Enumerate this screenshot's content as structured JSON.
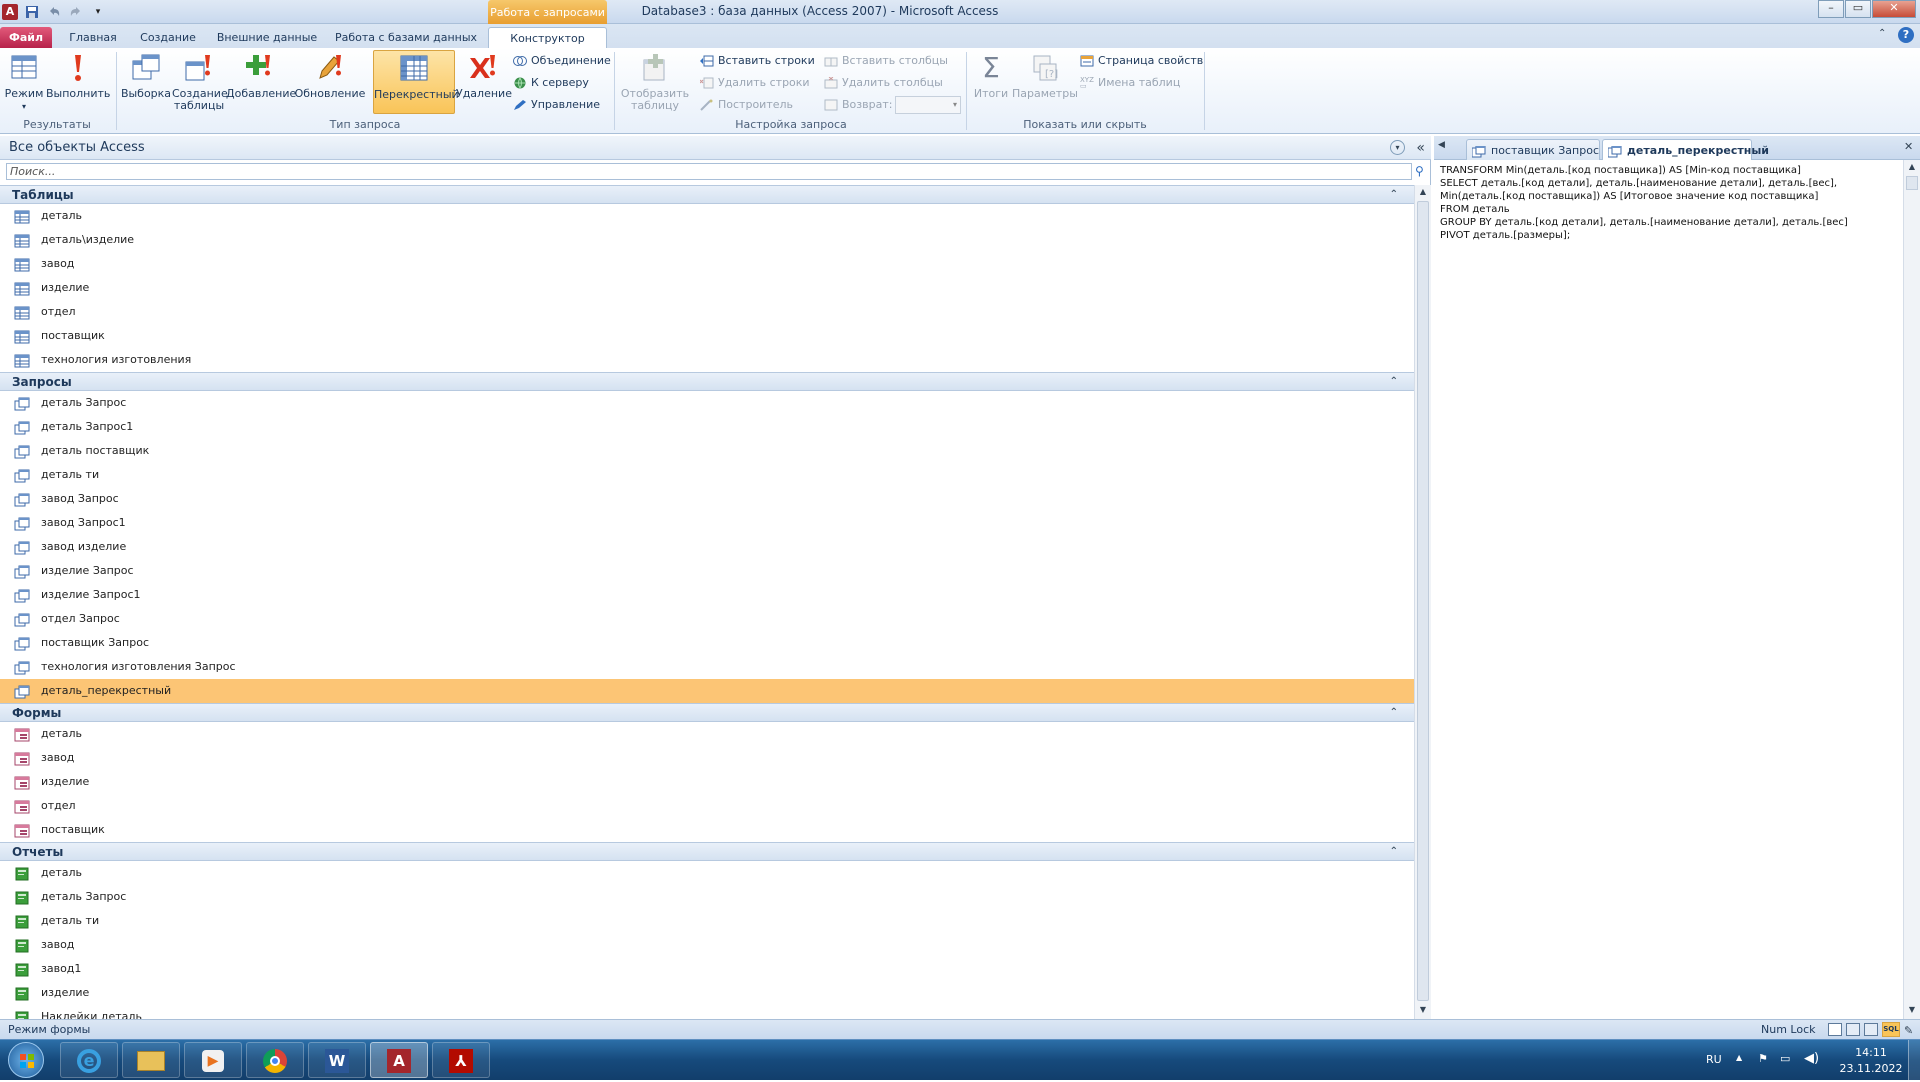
{
  "window": {
    "title": "Database3 : база данных (Access 2007)  -  Microsoft Access",
    "context_tab_group": "Работа с запросами",
    "controls": {
      "minimize": "–",
      "maximize": "▭",
      "close": "✕"
    }
  },
  "ribbon_tabs": [
    {
      "label": "Файл"
    },
    {
      "label": "Главная"
    },
    {
      "label": "Создание"
    },
    {
      "label": "Внешние данные"
    },
    {
      "label": "Работа с базами данных"
    },
    {
      "label": "Конструктор"
    }
  ],
  "ribbon": {
    "results": {
      "label": "Результаты",
      "view": "Режим",
      "run": "Выполнить"
    },
    "query_type": {
      "label": "Тип запроса",
      "select": "Выборка",
      "make_table_1": "Создание",
      "make_table_2": "таблицы",
      "append": "Добавление",
      "update": "Обновление",
      "crosstab": "Перекрестный",
      "delete": "Удаление",
      "union": "Объединение",
      "passthrough": "К серверу",
      "data_def": "Управление"
    },
    "setup": {
      "label": "Настройка запроса",
      "show_table_1": "Отобразить",
      "show_table_2": "таблицу",
      "insert_rows": "Вставить строки",
      "delete_rows": "Удалить строки",
      "builder": "Построитель",
      "insert_cols": "Вставить столбцы",
      "delete_cols": "Удалить столбцы",
      "return": "Возврат:"
    },
    "show_hide": {
      "label": "Показать или скрыть",
      "totals": "Итоги",
      "params": "Параметры",
      "property_sheet": "Страница свойств",
      "table_names": "Имена таблиц"
    }
  },
  "nav": {
    "title": "Все объекты Access",
    "search_placeholder": "Поиск...",
    "sections": [
      {
        "title": "Таблицы",
        "icon": "table-icon",
        "items": [
          "деталь",
          "деталь\\изделие",
          "завод",
          "изделие",
          "отдел",
          "поставщик",
          "технология изготовления"
        ]
      },
      {
        "title": "Запросы",
        "icon": "query-icon",
        "items": [
          "деталь Запрос",
          "деталь Запрос1",
          "деталь поставщик",
          "деталь ти",
          "завод Запрос",
          "завод Запрос1",
          "завод изделие",
          "изделие Запрос",
          "изделие Запрос1",
          "отдел Запрос",
          "поставщик Запрос",
          "технология изготовления Запрос",
          "деталь_перекрестный"
        ],
        "selected": "деталь_перекрестный"
      },
      {
        "title": "Формы",
        "icon": "form-icon",
        "items": [
          "деталь",
          "завод",
          "изделие",
          "отдел",
          "поставщик"
        ]
      },
      {
        "title": "Отчеты",
        "icon": "report-icon",
        "items": [
          "деталь",
          "деталь Запрос",
          "деталь ти",
          "завод",
          "завод1",
          "изделие",
          "Наклейки деталь"
        ]
      }
    ]
  },
  "doc": {
    "tabs": [
      "поставщик Запрос",
      "деталь_перекрестный"
    ],
    "active_tab": "деталь_перекрестный",
    "sql": "TRANSFORM Min(деталь.[код поставщика]) AS [Min-код поставщика]\nSELECT деталь.[код детали], деталь.[наименование детали], деталь.[вес],\nMin(деталь.[код поставщика]) AS [Итоговое значение код поставщика]\nFROM деталь\nGROUP BY деталь.[код детали], деталь.[наименование детали], деталь.[вес]\nPIVOT деталь.[размеры];"
  },
  "status": {
    "mode": "Режим формы",
    "num_lock": "Num Lock",
    "sql_label": "SQL"
  },
  "taskbar": {
    "lang": "RU",
    "time": "14:11",
    "date": "23.11.2022"
  },
  "colors": {
    "selected_row": "#fcc575",
    "file_tab": "#b7224a",
    "context_tab": "#e89e30"
  }
}
